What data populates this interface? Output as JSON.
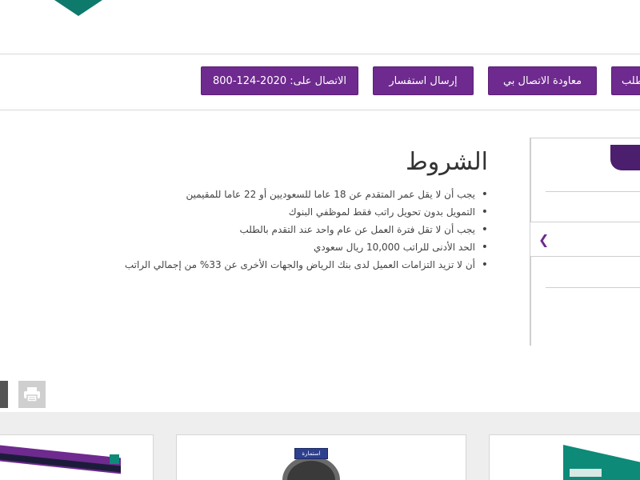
{
  "header": {
    "brand_color": "#0d7a6b"
  },
  "actions": {
    "call_label": "الاتصال على: 2020-124-800",
    "inquiry_label": "إرسال استفسار",
    "callback_label": "معاودة الاتصال بي",
    "apply_label": "طلب",
    "button_color": "#6e2a8e"
  },
  "conditions": {
    "title": "الشروط",
    "items": [
      "يجب أن لا يقل عمر المتقدم عن 18 عاما للسعوديين أو 22 عاما للمقيمين",
      "التمويل بدون تحويل راتب فقط لموظفي البنوك",
      "يجب أن لا تقل فترة العمل عن عام واحد عند التقدم بالطلب",
      "الحد الأدنى للراتب 10,000 ريال سعودي",
      "أن لا تزيد التزامات العميل لدى بنك الرياض والجهات الأخرى عن 33% من إجمالي الراتب"
    ]
  },
  "sidebar": {
    "chevron_icon": "chevron-left-icon",
    "accent_color": "#4b1e6e"
  },
  "tools": {
    "print_icon": "printer-icon",
    "share_icon": "share-icon"
  },
  "cards": {
    "sign_text": "استمارة"
  }
}
